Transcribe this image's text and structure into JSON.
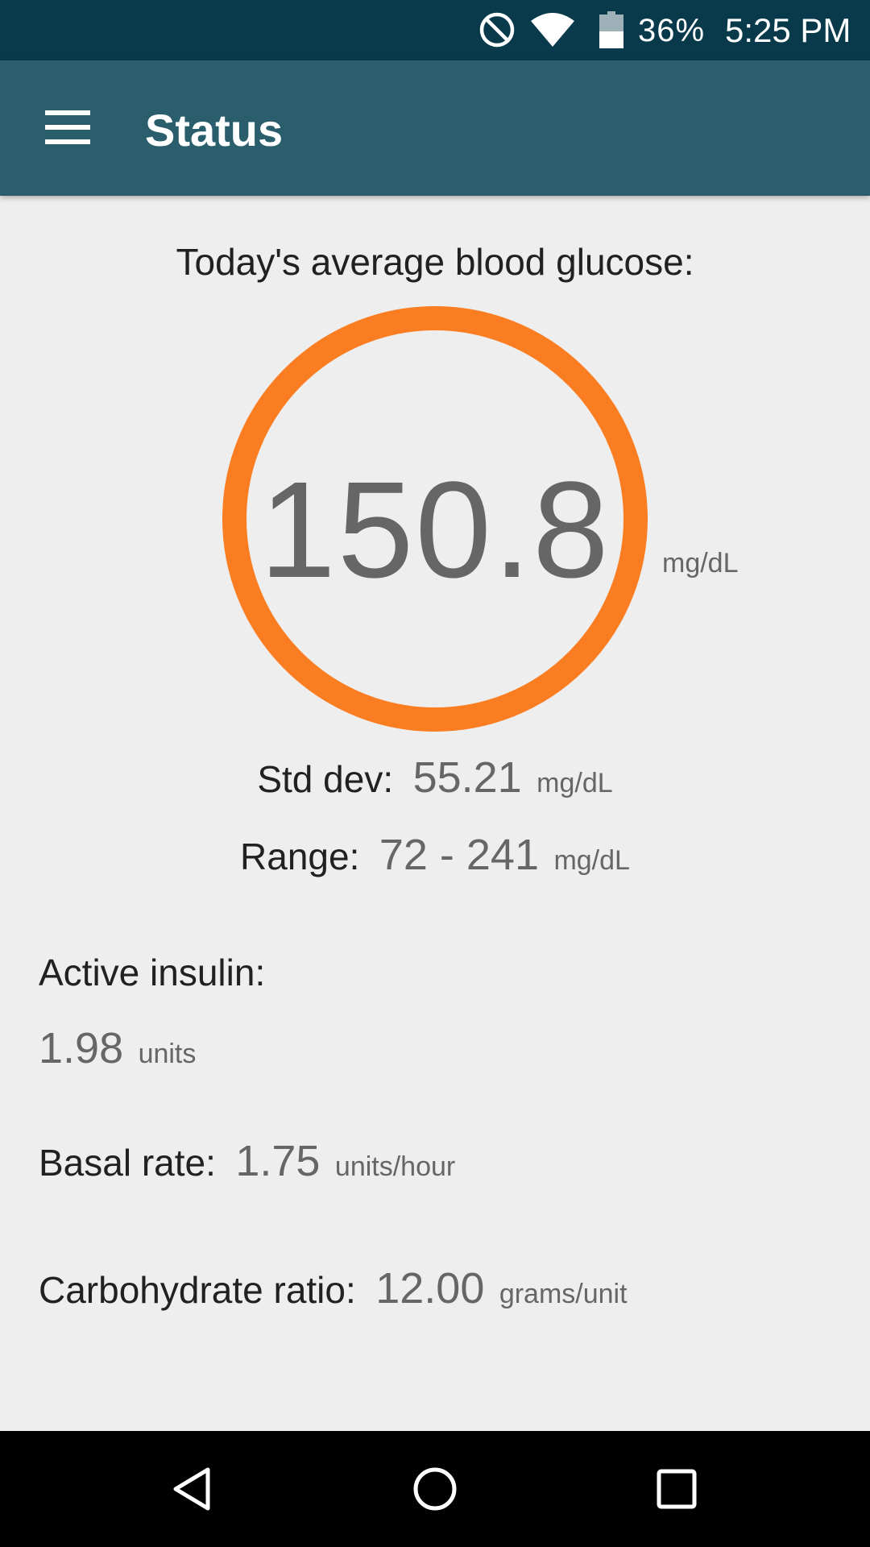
{
  "status_bar": {
    "battery_percent": "36%",
    "time": "5:25 PM",
    "icons": [
      "do-not-disturb-icon",
      "wifi-icon",
      "battery-icon"
    ],
    "background_color": "#083a4b"
  },
  "app_bar": {
    "title": "Status",
    "menu_icon": "hamburger-menu-icon",
    "background_color": "#2b5e6d"
  },
  "glucose": {
    "label": "Today's average blood glucose:",
    "average_value": "150.8",
    "unit": "mg/dL",
    "ring_color": "#fa7d22",
    "std_dev": {
      "label": "Std dev:",
      "value": "55.21",
      "unit": "mg/dL"
    },
    "range": {
      "label": "Range:",
      "value": "72 - 241",
      "unit": "mg/dL"
    }
  },
  "insulin": {
    "active": {
      "label": "Active insulin:",
      "value": "1.98",
      "unit": "units"
    },
    "basal_rate": {
      "label": "Basal rate:",
      "value": "1.75",
      "unit": "units/hour"
    },
    "carb_ratio": {
      "label": "Carbohydrate ratio:",
      "value": "12.00",
      "unit": "grams/unit"
    }
  },
  "nav_bar": {
    "icons": [
      "back-icon",
      "home-icon",
      "recents-icon"
    ]
  }
}
